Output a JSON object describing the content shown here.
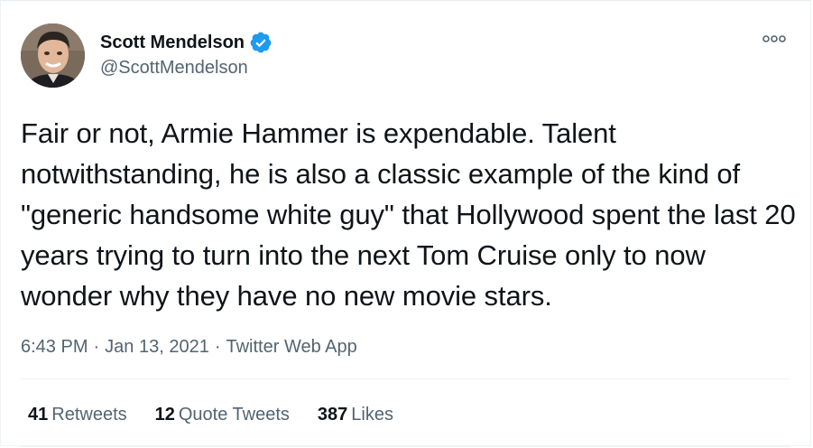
{
  "author": {
    "display_name": "Scott Mendelson",
    "handle": "@ScottMendelson",
    "verified": true
  },
  "tweet": {
    "text": "Fair or not, Armie Hammer is expendable. Talent notwithstanding, he is also a classic example of the kind of \"generic handsome white guy\" that Hollywood spent the last 20 years trying to turn into the next Tom Cruise only to now wonder why they have no new movie stars.",
    "time": "6:43 PM",
    "separator": "·",
    "date": "Jan 13, 2021",
    "source": "Twitter Web App"
  },
  "stats": {
    "retweets_count": "41",
    "retweets_label": "Retweets",
    "quotes_count": "12",
    "quotes_label": "Quote Tweets",
    "likes_count": "387",
    "likes_label": "Likes"
  },
  "icons": {
    "verified": "verified-badge-icon",
    "more": "more-options-icon"
  },
  "colors": {
    "verified_blue": "#1d9bf0",
    "text_primary": "#0f1419",
    "text_secondary": "#536471",
    "divider": "#eff3f4"
  }
}
